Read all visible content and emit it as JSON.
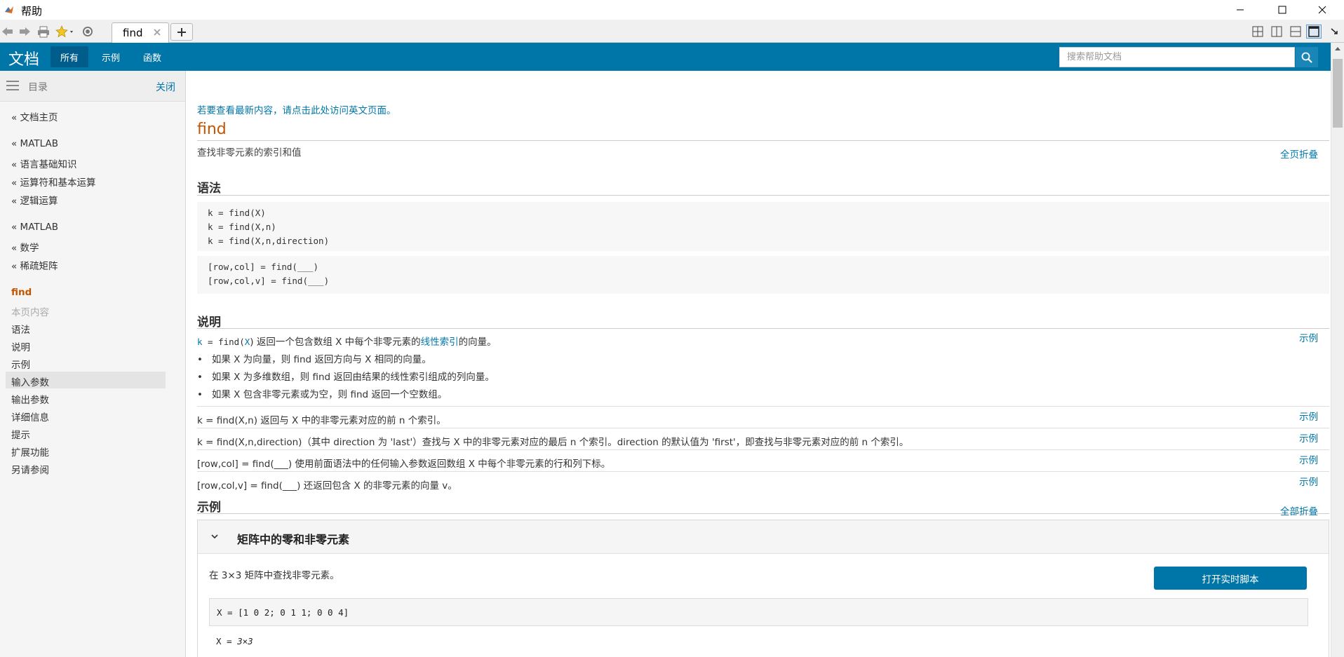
{
  "window": {
    "title": "帮助",
    "minimize_icon": "minimize-icon",
    "maximize_icon": "maximize-icon",
    "close_icon": "close-icon"
  },
  "tabbar": {
    "tab_label": "find",
    "icons": [
      "back-arrow-icon",
      "forward-arrow-icon",
      "print-icon",
      "favorites-star-icon",
      "settings-gear-icon",
      "new-tab-plus-icon"
    ],
    "layout_icons": [
      "tile-grid-icon",
      "split-vertical-icon",
      "split-horizontal-icon",
      "single-pane-icon",
      "undock-icon"
    ]
  },
  "header": {
    "title": "文档",
    "tabs": [
      {
        "label": "所有",
        "active": true
      },
      {
        "label": "示例",
        "active": false
      },
      {
        "label": "函数",
        "active": false
      }
    ],
    "search_placeholder": "搜索帮助文档"
  },
  "sidebar": {
    "toc_label": "目录",
    "close_label": "关闭",
    "items": [
      {
        "label": "« 文档主页"
      },
      {
        "label": "« MATLAB"
      },
      {
        "label": "« 语言基础知识"
      },
      {
        "label": "« 运算符和基本运算"
      },
      {
        "label": "« 逻辑运算"
      },
      {
        "label": "« MATLAB"
      },
      {
        "label": "« 数学"
      },
      {
        "label": "« 稀疏矩阵"
      },
      {
        "label": "find"
      },
      {
        "label": "本页内容"
      },
      {
        "label": "语法"
      },
      {
        "label": "说明"
      },
      {
        "label": "示例"
      },
      {
        "label": "输入参数"
      },
      {
        "label": "输出参数"
      },
      {
        "label": "详细信息"
      },
      {
        "label": "提示"
      },
      {
        "label": "扩展功能"
      },
      {
        "label": "另请参阅"
      }
    ]
  },
  "main": {
    "notice": "若要查看最新内容，请点击此处访问英文页面。",
    "title": "find",
    "purpose": "查找非零元素的索引和值",
    "collapse_all_page": "全页折叠",
    "syntax_heading": "语法",
    "syntax_lines_1": [
      "k = find(X)",
      "k = find(X,n)",
      "k = find(X,n,direction)"
    ],
    "syntax_lines_2": [
      "[row,col] = find(___)",
      "[row,col,v] = find(___)"
    ],
    "description_heading": "说明",
    "example_link": "示例",
    "desc1": {
      "pre": "k",
      "mid1": " = find(",
      "arg": "X",
      "mid2": ") 返回一个包含数组 X 中每个非零元素的",
      "link": "线性索引",
      "post": "的向量。"
    },
    "bullets": [
      "如果 X 为向量，则 find 返回方向与 X 相同的向量。",
      "如果 X 为多维数组，则 find 返回由结果的线性索引组成的列向量。",
      "如果 X 包含非零元素或为空，则 find 返回一个空数组。"
    ],
    "desc2": "k = find(X,n) 返回与 X 中的非零元素对应的前 n 个索引。",
    "desc3": "k = find(X,n,direction)（其中 direction 为 'last'）查找与 X 中的非零元素对应的最后 n 个索引。direction 的默认值为 'first'，即查找与非零元素对应的前 n 个索引。",
    "desc4": "[row,col] = find(___) 使用前面语法中的任何输入参数返回数组 X 中每个非零元素的行和列下标。",
    "desc5": "[row,col,v] = find(___) 还返回包含 X 的非零元素的向量 v。",
    "examples_heading": "示例",
    "collapse_all": "全部折叠",
    "example": {
      "title": "矩阵中的零和非零元素",
      "text": "在 3×3 矩阵中查找非零元素。",
      "button": "打开实时脚本",
      "code": "X = [1 0 2; 0 1 1; 0 0 4]",
      "output_prefix": "X = ",
      "output_size": "3×3"
    }
  },
  "colors": {
    "header_blue": "#0076a8",
    "title_orange": "#c45400",
    "link_blue": "#0076a8"
  }
}
